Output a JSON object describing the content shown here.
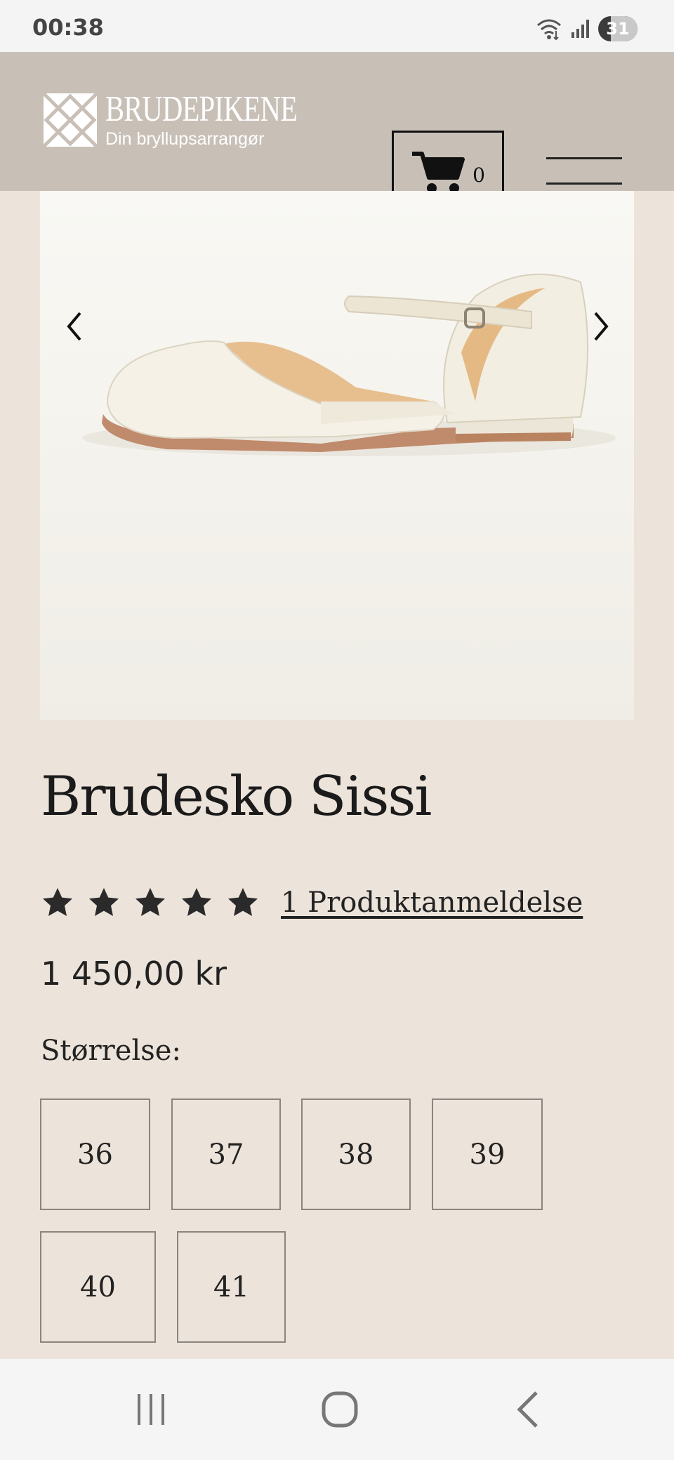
{
  "status_bar": {
    "time": "00:38",
    "battery": "31",
    "icons": [
      "wifi-icon",
      "signal-icon",
      "battery-icon"
    ]
  },
  "header": {
    "logo_name": "BRUDEPIKENE",
    "logo_tagline": "Din bryllupsarrangør",
    "cart_count": "0",
    "icons": [
      "logo-mark-icon",
      "cart-icon",
      "hamburger-menu-icon"
    ],
    "background_color": "#c8c0b7"
  },
  "gallery": {
    "image_subject": "ivory satin flat shoe with ankle strap",
    "icons": [
      "chevron-left-icon",
      "chevron-right-icon"
    ]
  },
  "product": {
    "title": "Brudesko Sissi",
    "rating": 5,
    "rating_max": 5,
    "review_link": "1 Produktanmeldelse",
    "price": "1 450,00 kr",
    "size_label": "Størrelse:",
    "sizes": [
      "36",
      "37",
      "38",
      "39",
      "40",
      "41"
    ]
  },
  "nav_bar": {
    "icons": [
      "recent-apps-icon",
      "home-icon",
      "back-icon"
    ]
  },
  "colors": {
    "page_background": "#ece3da",
    "text": "#1d1d1d"
  }
}
